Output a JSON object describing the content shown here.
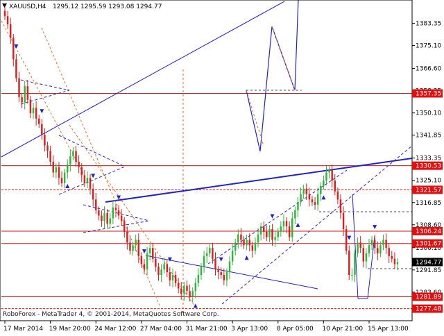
{
  "header": {
    "symbol": "XAUUSD,H4",
    "ohlc": "1295.12 1295.59 1293.08 1294.77"
  },
  "footer": {
    "copyright": "RoboForex - MetaTrader 4, © 2001-2014, MetaQuotes Software Corp."
  },
  "colors": {
    "bull": "#2fb53a",
    "bear": "#d92020",
    "level": "#e01010",
    "channel": "#2222cc",
    "projection": "#e07030",
    "guide": "#444466",
    "axis": "#000000"
  },
  "chart_data": {
    "type": "candlestick",
    "symbol": "XAUUSD",
    "timeframe": "H4",
    "ylim": [
      1273,
      1392
    ],
    "y_ticks": [
      1383.35,
      1375.1,
      1366.6,
      1358.35,
      1350.1,
      1341.85,
      1333.35,
      1325.1,
      1316.85,
      1308.6,
      1300.1,
      1291.85,
      1283.6
    ],
    "x_ticks": [
      "17 Mar 2014",
      "19 Mar 20:00",
      "24 Mar 12:00",
      "27 Mar 04:00",
      "31 Mar 21:00",
      "3 Apr 13:00",
      "8 Apr 05:00",
      "10 Apr 21:00",
      "15 Apr 13:00"
    ],
    "x_tick_index": [
      0,
      16,
      32,
      48,
      64,
      80,
      96,
      112,
      128
    ],
    "horizontal_levels": [
      {
        "value": 1357.35,
        "style": "solid"
      },
      {
        "value": 1330.53,
        "style": "solid"
      },
      {
        "value": 1321.57,
        "style": "dotted"
      },
      {
        "value": 1306.24,
        "style": "solid"
      },
      {
        "value": 1301.67,
        "style": "solid"
      },
      {
        "value": 1281.89,
        "style": "solid"
      },
      {
        "value": 1277.48,
        "style": "dotted"
      }
    ],
    "current_price": 1294.77,
    "close": [
      1386,
      1383,
      1378,
      1370,
      1363,
      1356,
      1354,
      1360,
      1355,
      1350,
      1352,
      1348,
      1346,
      1342,
      1338,
      1336,
      1332,
      1328,
      1330,
      1326,
      1324,
      1328,
      1331,
      1334,
      1336,
      1332,
      1330,
      1327,
      1324,
      1326,
      1322,
      1318,
      1314,
      1312,
      1310,
      1313,
      1309,
      1311,
      1315,
      1314,
      1312,
      1310,
      1306,
      1302,
      1299,
      1301,
      1303,
      1297,
      1294,
      1292,
      1298,
      1300,
      1296,
      1293,
      1290,
      1292,
      1294,
      1291,
      1288,
      1290,
      1287,
      1285,
      1283,
      1286,
      1284,
      1282,
      1284,
      1287,
      1290,
      1293,
      1297,
      1298,
      1300,
      1296,
      1292,
      1291,
      1290,
      1288,
      1291,
      1295,
      1299,
      1302,
      1305,
      1303,
      1301,
      1303,
      1301,
      1299,
      1302,
      1305,
      1308,
      1306,
      1304,
      1307,
      1303,
      1304,
      1306,
      1308,
      1310,
      1308,
      1304,
      1311,
      1314,
      1317,
      1320,
      1322,
      1320,
      1318,
      1317,
      1316,
      1320,
      1323,
      1325,
      1328,
      1329,
      1325,
      1321,
      1318,
      1313,
      1307,
      1299,
      1290,
      1290,
      1298,
      1302,
      1300,
      1295,
      1298,
      1301,
      1303,
      1300,
      1298,
      1301,
      1303,
      1300,
      1297,
      1296,
      1294,
      1294.77
    ]
  }
}
